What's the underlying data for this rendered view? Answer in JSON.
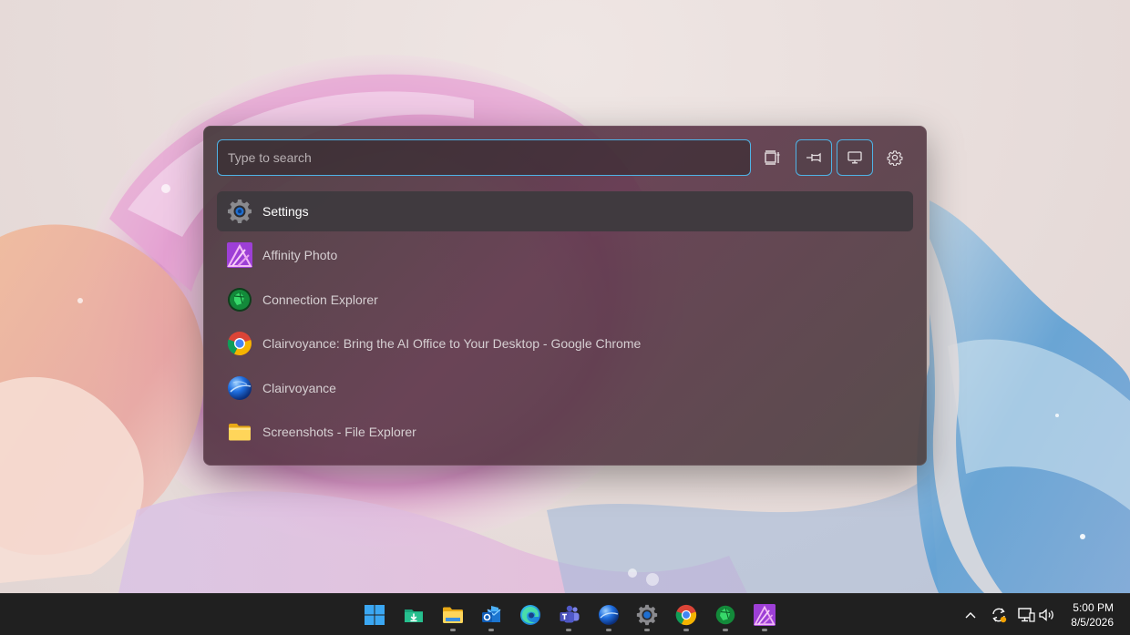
{
  "launcher": {
    "search": {
      "placeholder": "Type to search",
      "value": ""
    },
    "toolbar": [
      {
        "name": "layout-icon"
      },
      {
        "name": "pin-icon",
        "active": true
      },
      {
        "name": "monitor-icon",
        "active": true
      },
      {
        "name": "gear-icon"
      }
    ],
    "results": [
      {
        "label": "Settings",
        "icon": "settings-gear-icon",
        "selected": true
      },
      {
        "label": "Affinity Photo",
        "icon": "affinity-photo-icon"
      },
      {
        "label": "Connection Explorer",
        "icon": "connection-explorer-icon"
      },
      {
        "label": "Clairvoyance: Bring the AI Office to Your Desktop - Google Chrome",
        "icon": "chrome-icon"
      },
      {
        "label": "Clairvoyance",
        "icon": "clairvoyance-globe-icon"
      },
      {
        "label": "Screenshots - File Explorer",
        "icon": "folder-icon"
      }
    ],
    "accent_color": "#4fb3e6"
  },
  "taskbar": {
    "apps": [
      "start-icon",
      "download-manager-icon",
      "file-explorer-icon",
      "outlook-icon",
      "edge-icon",
      "teams-icon",
      "clairvoyance-globe-icon",
      "settings-gear-icon",
      "chrome-icon",
      "connection-explorer-icon",
      "affinity-photo-icon"
    ],
    "clock": {
      "time": "5:00 PM",
      "date": "8/5/2026"
    }
  }
}
